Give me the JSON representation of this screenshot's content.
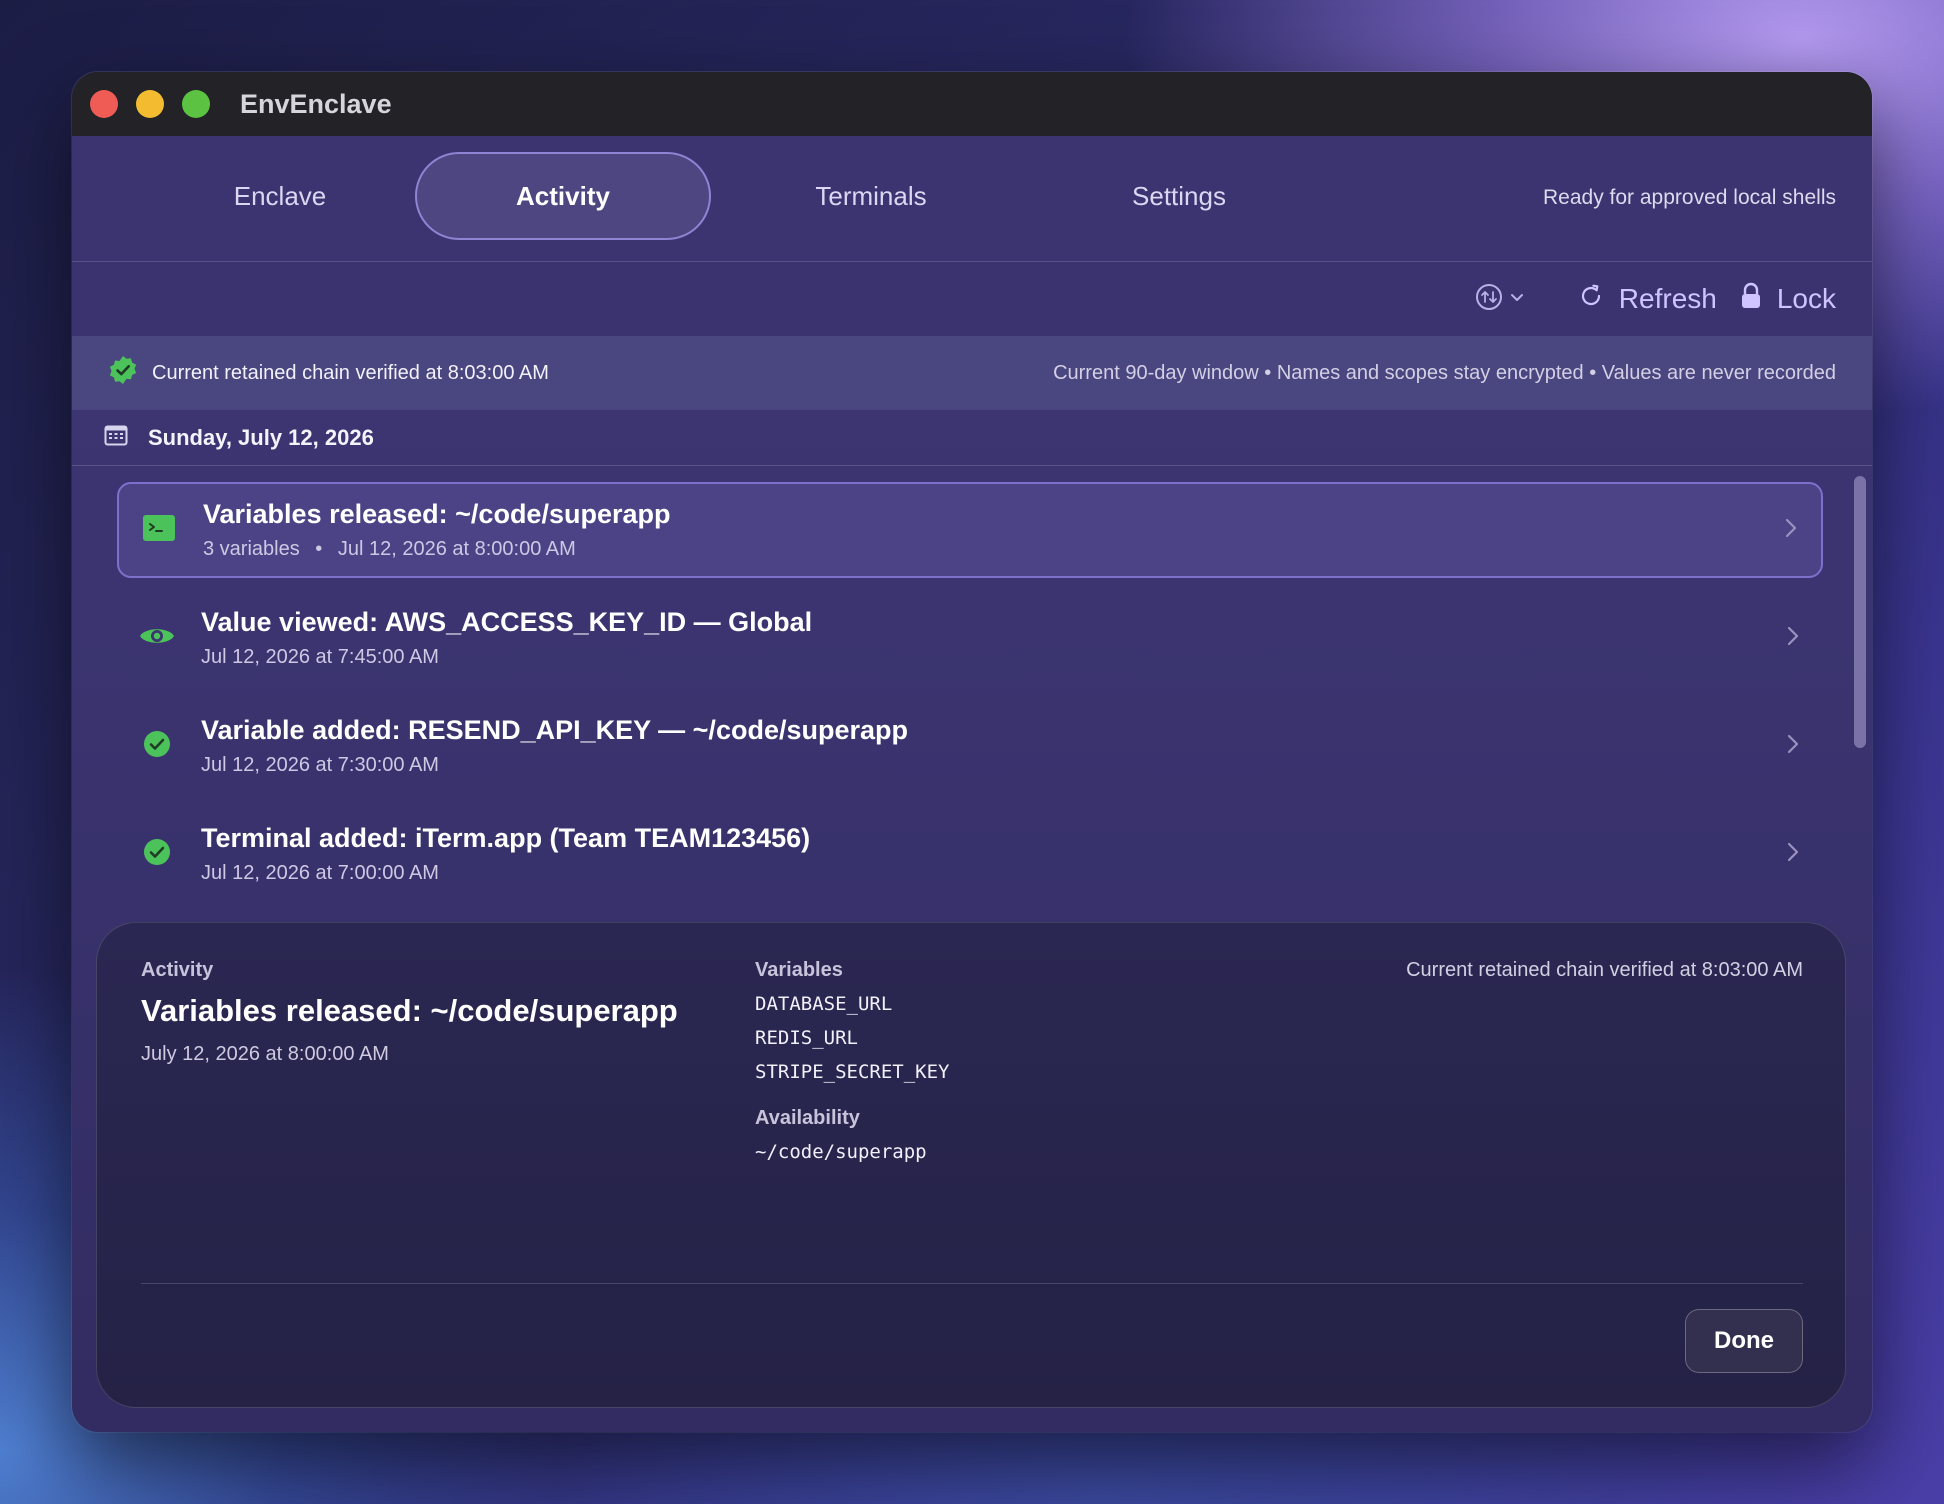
{
  "app": {
    "title": "EnvEnclave"
  },
  "tabs": [
    {
      "label": "Enclave"
    },
    {
      "label": "Activity",
      "active": true
    },
    {
      "label": "Terminals"
    },
    {
      "label": "Settings"
    }
  ],
  "status": {
    "ready_text": "Ready for approved local shells"
  },
  "toolbar": {
    "refresh_label": "Refresh",
    "lock_label": "Lock"
  },
  "banner": {
    "verified_text": "Current retained chain verified at 8:03:00 AM",
    "info_text": "Current 90-day window • Names and scopes stay encrypted • Values are never recorded"
  },
  "date_header": "Sunday, July 12, 2026",
  "activities": [
    {
      "icon": "terminal-icon",
      "title": "Variables released: ~/code/superapp",
      "count": "3 variables",
      "separator": "•",
      "time": "Jul 12, 2026 at 8:00:00 AM",
      "selected": true
    },
    {
      "icon": "eye-icon",
      "title": "Value viewed: AWS_ACCESS_KEY_ID — Global",
      "time": "Jul 12, 2026 at 7:45:00 AM"
    },
    {
      "icon": "check-circle-icon",
      "title": "Variable added: RESEND_API_KEY — ~/code/superapp",
      "time": "Jul 12, 2026 at 7:30:00 AM"
    },
    {
      "icon": "check-circle-icon",
      "title": "Terminal added: iTerm.app (Team TEAM123456)",
      "time": "Jul 12, 2026 at 7:00:00 AM"
    }
  ],
  "detail": {
    "section_label": "Activity",
    "title": "Variables released: ~/code/superapp",
    "date": "July 12, 2026 at 8:00:00 AM",
    "variables_label": "Variables",
    "variables": [
      "DATABASE_URL",
      "REDIS_URL",
      "STRIPE_SECRET_KEY"
    ],
    "availability_label": "Availability",
    "availability": "~/code/superapp",
    "verified_text": "Current retained chain verified at 8:03:00 AM",
    "done_label": "Done"
  },
  "colors": {
    "accent": "#cfc4ff",
    "success": "#4cc35a",
    "selected_border": "#7d70cc"
  }
}
